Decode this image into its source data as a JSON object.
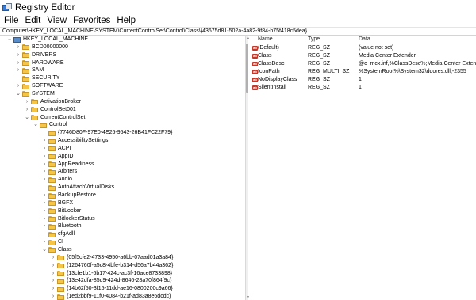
{
  "window": {
    "title": "Registry Editor"
  },
  "menu": [
    "File",
    "Edit",
    "View",
    "Favorites",
    "Help"
  ],
  "address": "Computer\\HKEY_LOCAL_MACHINE\\SYSTEM\\CurrentControlSet\\Control\\Class\\{43675d81-502a-4a82-9f84-b75f418c5dea}",
  "tree": [
    {
      "label": "HKEY_LOCAL_MACHINE",
      "toggle": "v",
      "depth": 0,
      "icon": "computer"
    },
    {
      "label": "BCD00000000",
      "toggle": ">",
      "depth": 1,
      "icon": "folder"
    },
    {
      "label": "DRIVERS",
      "toggle": ">",
      "depth": 1,
      "icon": "folder"
    },
    {
      "label": "HARDWARE",
      "toggle": ">",
      "depth": 1,
      "icon": "folder"
    },
    {
      "label": "SAM",
      "toggle": ">",
      "depth": 1,
      "icon": "folder"
    },
    {
      "label": "SECURITY",
      "toggle": "",
      "depth": 1,
      "icon": "folder"
    },
    {
      "label": "SOFTWARE",
      "toggle": ">",
      "depth": 1,
      "icon": "folder"
    },
    {
      "label": "SYSTEM",
      "toggle": "v",
      "depth": 1,
      "icon": "folder"
    },
    {
      "label": "ActivationBroker",
      "toggle": ">",
      "depth": 2,
      "icon": "folder"
    },
    {
      "label": "ControlSet001",
      "toggle": ">",
      "depth": 2,
      "icon": "folder"
    },
    {
      "label": "CurrentControlSet",
      "toggle": "v",
      "depth": 2,
      "icon": "folder"
    },
    {
      "label": "Control",
      "toggle": "v",
      "depth": 3,
      "icon": "folder"
    },
    {
      "label": "{7746D80F-97E0-4E26-9543-26B41FC22F79}",
      "toggle": "",
      "depth": 4,
      "icon": "folder"
    },
    {
      "label": "AccessibilitySettings",
      "toggle": ">",
      "depth": 4,
      "icon": "folder"
    },
    {
      "label": "ACPI",
      "toggle": ">",
      "depth": 4,
      "icon": "folder"
    },
    {
      "label": "AppID",
      "toggle": ">",
      "depth": 4,
      "icon": "folder"
    },
    {
      "label": "AppReadiness",
      "toggle": ">",
      "depth": 4,
      "icon": "folder"
    },
    {
      "label": "Arbiters",
      "toggle": ">",
      "depth": 4,
      "icon": "folder"
    },
    {
      "label": "Audio",
      "toggle": ">",
      "depth": 4,
      "icon": "folder"
    },
    {
      "label": "AutoAttachVirtualDisks",
      "toggle": "",
      "depth": 4,
      "icon": "folder"
    },
    {
      "label": "BackupRestore",
      "toggle": ">",
      "depth": 4,
      "icon": "folder"
    },
    {
      "label": "BGFX",
      "toggle": ">",
      "depth": 4,
      "icon": "folder"
    },
    {
      "label": "BitLocker",
      "toggle": ">",
      "depth": 4,
      "icon": "folder"
    },
    {
      "label": "BitlockerStatus",
      "toggle": ">",
      "depth": 4,
      "icon": "folder"
    },
    {
      "label": "Bluetooth",
      "toggle": ">",
      "depth": 4,
      "icon": "folder"
    },
    {
      "label": "cfgAdll",
      "toggle": "",
      "depth": 4,
      "icon": "folder"
    },
    {
      "label": "CI",
      "toggle": ">",
      "depth": 4,
      "icon": "folder"
    },
    {
      "label": "Class",
      "toggle": "v",
      "depth": 4,
      "icon": "folder"
    },
    {
      "label": "{05f5cfe2-4733-4950-a6bb-07aad01a3a84}",
      "toggle": ">",
      "depth": 5,
      "icon": "folder"
    },
    {
      "label": "{1264760f-a5c8-4bfe-b314-d56a7b44a362}",
      "toggle": ">",
      "depth": 5,
      "icon": "folder"
    },
    {
      "label": "{13cfe1b1-6b17-424c-ac3f-16ace8733898}",
      "toggle": ">",
      "depth": 5,
      "icon": "folder"
    },
    {
      "label": "{13e42dfa-85d9-424d-8646-28a70f864f9c}",
      "toggle": ">",
      "depth": 5,
      "icon": "folder"
    },
    {
      "label": "{14b62f50-3f15-11dd-ae16-0800200c9a66}",
      "toggle": ">",
      "depth": 5,
      "icon": "folder"
    },
    {
      "label": "{1ed2bbf9-11f0-4084-b21f-ad83a8e6dcdc}",
      "toggle": ">",
      "depth": 5,
      "icon": "folder"
    }
  ],
  "columns": {
    "name": "Name",
    "type": "Type",
    "data": "Data"
  },
  "values": [
    {
      "name": "(Default)",
      "type": "REG_SZ",
      "data": "(value not set)",
      "icon": "str"
    },
    {
      "name": "Class",
      "type": "REG_SZ",
      "data": "Media Center Extender",
      "icon": "str"
    },
    {
      "name": "ClassDesc",
      "type": "REG_SZ",
      "data": "@c_mcx.inf,%ClassDesc%;Media Center Extenders",
      "icon": "str"
    },
    {
      "name": "IconPath",
      "type": "REG_MULTI_SZ",
      "data": "%SystemRoot%\\System32\\ddores.dll,-2355",
      "icon": "str"
    },
    {
      "name": "NoDisplayClass",
      "type": "REG_SZ",
      "data": "1",
      "icon": "str"
    },
    {
      "name": "SilentInstall",
      "type": "REG_SZ",
      "data": "1",
      "icon": "str"
    }
  ]
}
